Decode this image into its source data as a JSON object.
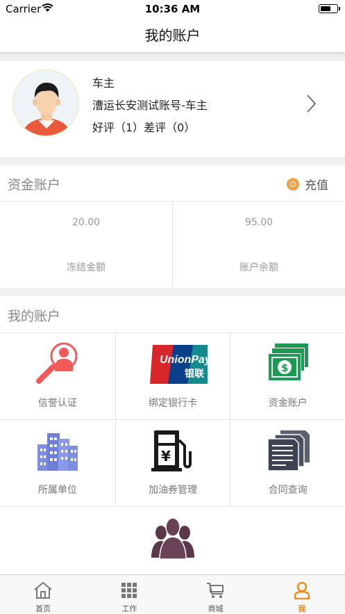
{
  "status_bar": {
    "carrier": "Carrier",
    "time": "10:36 AM"
  },
  "nav": {
    "title": "我的账户"
  },
  "profile": {
    "name": "车主",
    "account": "漕运长安测试账号-车主",
    "rating": "好评（1）差评（0）"
  },
  "capital": {
    "title": "资金账户",
    "recharge_label": "充值",
    "frozen_amount": "20.00",
    "frozen_label": "冻结金额",
    "balance_amount": "95.00",
    "balance_label": "账户余额"
  },
  "my_account": {
    "title": "我的账户",
    "items": [
      {
        "label": "信誉认证",
        "icon": "credit-search-icon"
      },
      {
        "label": "绑定银行卡",
        "icon": "unionpay-icon"
      },
      {
        "label": "资金账户",
        "icon": "money-stack-icon"
      },
      {
        "label": "所属单位",
        "icon": "buildings-icon"
      },
      {
        "label": "加油券管理",
        "icon": "fuel-pump-icon"
      },
      {
        "label": "合同查询",
        "icon": "documents-icon"
      },
      {
        "label": "",
        "icon": "team-icon"
      }
    ]
  },
  "tabbar": {
    "tabs": [
      {
        "label": "首页",
        "icon": "home-icon"
      },
      {
        "label": "工作",
        "icon": "grid-icon"
      },
      {
        "label": "商城",
        "icon": "cart-icon"
      },
      {
        "label": "我",
        "icon": "person-icon"
      }
    ],
    "active_color": "#f08a1c"
  },
  "unionpay_text": {
    "union": "UnionPay",
    "cn": "银联"
  },
  "fuel_symbol": "¥"
}
